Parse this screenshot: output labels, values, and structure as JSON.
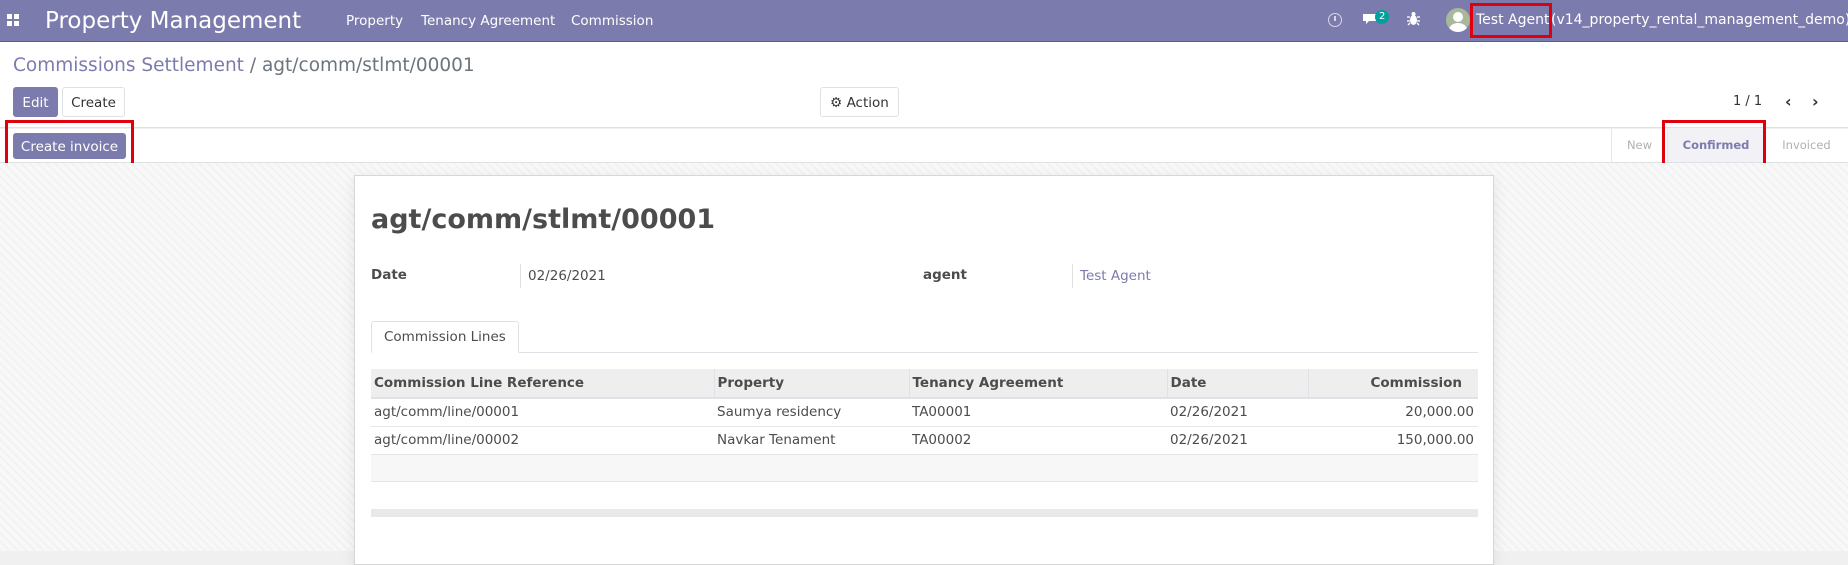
{
  "navbar": {
    "brand": "Property Management",
    "menu": [
      "Property",
      "Tenancy Agreement",
      "Commission"
    ],
    "chat_count": "2",
    "user": "Test Agent",
    "database": "(v14_property_rental_management_demo)"
  },
  "breadcrumb": {
    "parent": "Commissions Settlement",
    "separator": "/",
    "current": "agt/comm/stlmt/00001"
  },
  "toolbar": {
    "edit_label": "Edit",
    "create_label": "Create",
    "action_label": "Action",
    "pager": "1 / 1"
  },
  "statusbar": {
    "create_invoice_label": "Create invoice",
    "steps": [
      "New",
      "Confirmed",
      "Invoiced"
    ],
    "active_step": "Confirmed"
  },
  "record": {
    "title": "agt/comm/stlmt/00001",
    "date_label": "Date",
    "date_value": "02/26/2021",
    "agent_label": "agent",
    "agent_value": "Test Agent"
  },
  "tabs": [
    {
      "label": "Commission Lines"
    }
  ],
  "lines": {
    "headers": [
      "Commission Line Reference",
      "Property",
      "Tenancy Agreement",
      "Date",
      "Commission"
    ],
    "rows": [
      {
        "ref": "agt/comm/line/00001",
        "property": "Saumya residency",
        "agreement": "TA00001",
        "date": "02/26/2021",
        "commission": "20,000.00"
      },
      {
        "ref": "agt/comm/line/00002",
        "property": "Navkar Tenament",
        "agreement": "TA00002",
        "date": "02/26/2021",
        "commission": "150,000.00"
      }
    ]
  },
  "colors": {
    "brand": "#7c7bad",
    "highlight": "#e0000d"
  }
}
